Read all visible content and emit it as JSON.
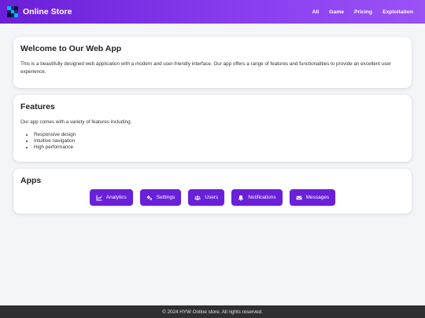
{
  "brand": {
    "name": "Online Store"
  },
  "nav": {
    "links": [
      "All",
      "Game",
      "Pricing",
      "Exploitation"
    ]
  },
  "welcome": {
    "title": "Welcome to Our Web App",
    "text": "This is a beautifully designed web application with a modern and user-friendly interface. Our app offers a range of features and functionalities to provide an excellent user experience."
  },
  "features": {
    "title": "Features",
    "intro": "Our app comes with a variety of features including:",
    "items": [
      "Responsive design",
      "Intuitive navigation",
      "High performance"
    ]
  },
  "apps": {
    "title": "Apps",
    "buttons": [
      {
        "label": "Analytics",
        "icon": "chart-line-icon"
      },
      {
        "label": "Settings",
        "icon": "gears-icon"
      },
      {
        "label": "Users",
        "icon": "users-icon"
      },
      {
        "label": "Notifications",
        "icon": "bell-icon"
      },
      {
        "label": "Messages",
        "icon": "envelope-icon"
      }
    ]
  },
  "footer": {
    "text": "© 2024 HYW Online store. All rights reserved."
  },
  "colors": {
    "accent": "#6a1fd8",
    "footer_bg": "#2f2f33",
    "page_bg": "#f4f5f9"
  }
}
